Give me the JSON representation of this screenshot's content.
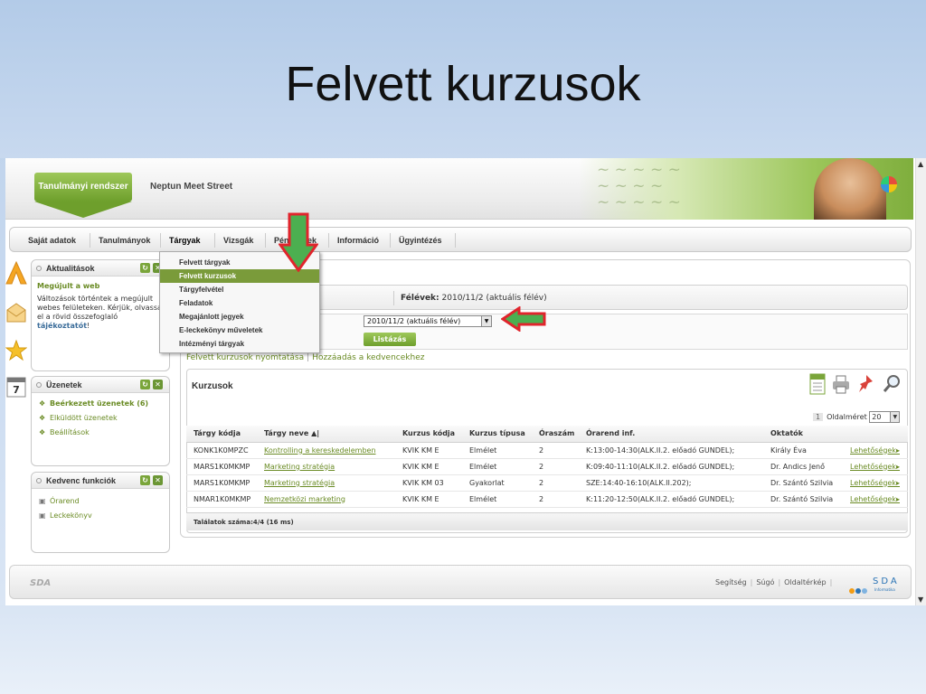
{
  "slide": {
    "title": "Felvett kurzusok"
  },
  "header": {
    "system_badge": "Tanulmányi rendszer",
    "app_name": "Neptun Meet Street"
  },
  "menu": {
    "items": [
      "Saját adatok",
      "Tanulmányok",
      "Tárgyak",
      "Vizsgák",
      "Pénzügyek",
      "Információ",
      "Ügyintézés"
    ],
    "active": "Tárgyak"
  },
  "dropdown": {
    "items": [
      "Felvett tárgyak",
      "Felvett kurzusok",
      "Tárgyfelvétel",
      "Feladatok",
      "Megajánlott jegyek",
      "E-leckekönyv műveletek",
      "Intézményi tárgyak"
    ],
    "active_index": 1
  },
  "side_icons": [
    "a-letter-icon",
    "envelope-icon",
    "star-icon",
    "calendar-icon"
  ],
  "calendar_day": "7",
  "panels": {
    "news": {
      "title": "Aktualitások",
      "headline": "Megújult a web",
      "body": "Változások történtek a megújult webes felületeken. Kérjük, olvassa el a rövid összefoglaló ",
      "link": "tájékoztatót",
      "end": "!"
    },
    "messages": {
      "title": "Üzenetek",
      "items": [
        "Beérkezett üzenetek (6)",
        "Elküldött üzenetek",
        "Beállítások"
      ]
    },
    "favorites": {
      "title": "Kedvenc funkciók",
      "items": [
        "Órarend",
        "Leckekönyv"
      ]
    }
  },
  "main": {
    "term_label": "Félévek:",
    "term_value": "2010/11/2 (aktuális félév)",
    "select_value": "2010/11/2 (aktuális félév)",
    "list_button": "Listázás",
    "link_print": "Felvett kurzusok nyomtatása",
    "link_fav": "Hozzáadás a kedvencekhez",
    "courses_title": "Kurzusok",
    "page_indicator": "1",
    "page_size_label": "Oldalméret",
    "page_size_value": "20",
    "columns": [
      "Tárgy kódja",
      "Tárgy neve",
      "Kurzus kódja",
      "Kurzus típusa",
      "Óraszám",
      "Órarend inf.",
      "Oktatók",
      ""
    ],
    "sort_marker": "▲|",
    "rows": [
      [
        "KONK1K0MPZC",
        "Kontrolling a kereskedelemben",
        "KVIK KM E",
        "Elmélet",
        "2",
        "K:13:00-14:30(ALK.II.2. előadó GUNDEL);",
        "Király Éva",
        "Lehetőségek"
      ],
      [
        "MARS1K0MKMP",
        "Marketing stratégia",
        "KVIK KM E",
        "Elmélet",
        "2",
        "K:09:40-11:10(ALK.II.2. előadó GUNDEL);",
        "Dr. Andics Jenő",
        "Lehetőségek"
      ],
      [
        "MARS1K0MKMP",
        "Marketing stratégia",
        "KVIK KM 03",
        "Gyakorlat",
        "2",
        "SZE:14:40-16:10(ALK.II.202);",
        "Dr. Szántó Szilvia",
        "Lehetőségek"
      ],
      [
        "NMAR1K0MKMP",
        "Nemzetközi marketing",
        "KVIK KM E",
        "Elmélet",
        "2",
        "K:11:20-12:50(ALK.II.2. előadó GUNDEL);",
        "Dr. Szántó Szilvia",
        "Lehetőségek"
      ]
    ],
    "results": "Találatok száma:4/4 (16 ms)"
  },
  "footer": {
    "logo": "SDA",
    "links": [
      "Segítség",
      "Súgó",
      "Oldaltérkép"
    ],
    "brand": "SDA",
    "brand_sub": "Informatika"
  },
  "colors": {
    "accent_green": "#6a8b24",
    "arrow_red": "#e0242c",
    "arrow_green": "#4caf50"
  }
}
